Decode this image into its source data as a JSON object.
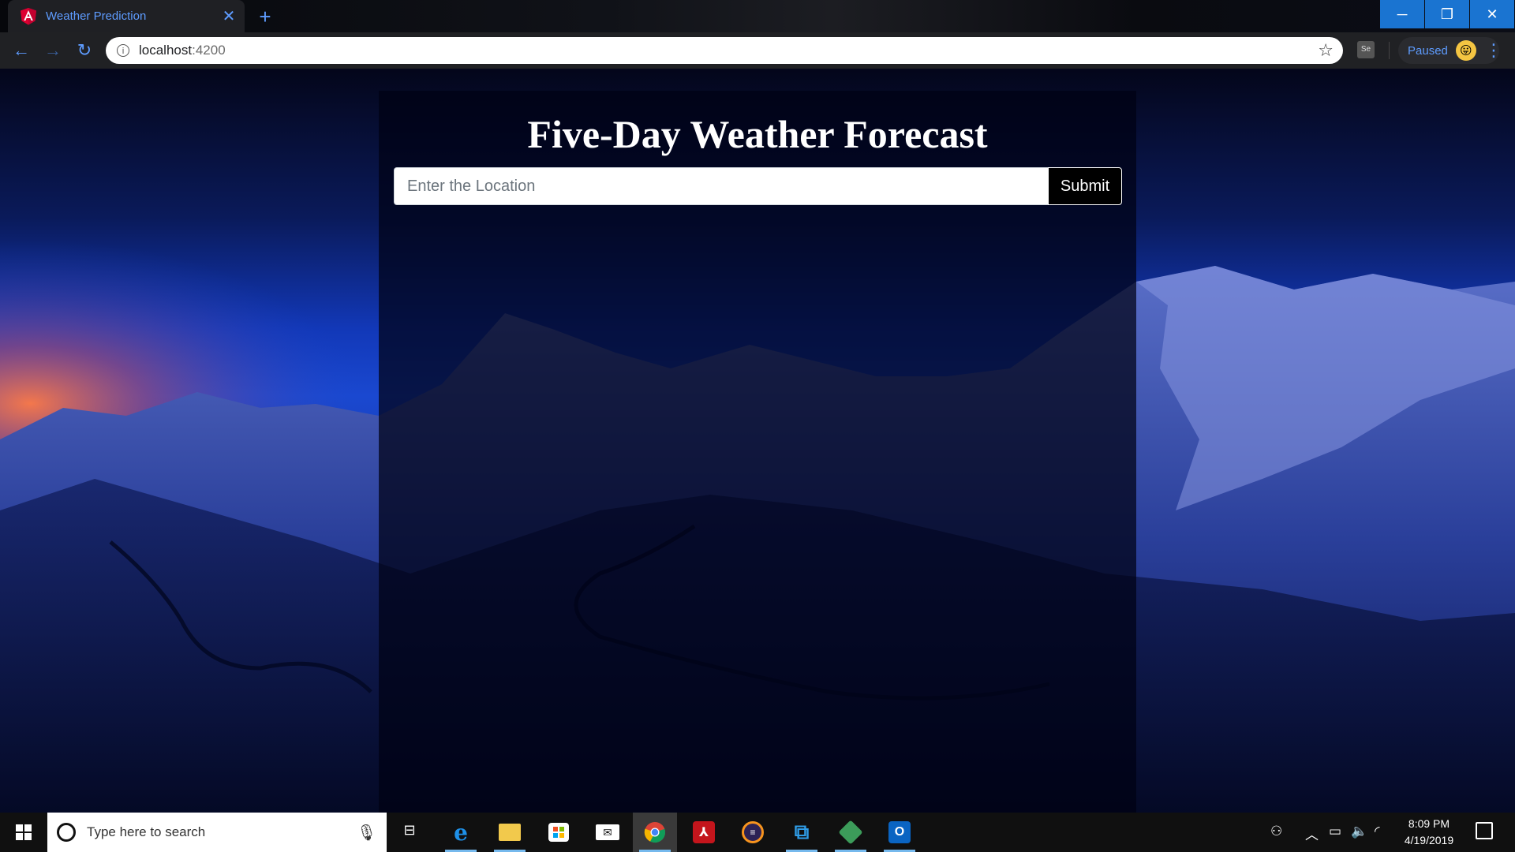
{
  "browser": {
    "tab_title": "Weather Prediction",
    "new_tab_label": "+",
    "url_host": "localhost",
    "url_port": ":4200",
    "profile_status": "Paused",
    "extension_label": "Se"
  },
  "page": {
    "title": "Five-Day Weather Forecast",
    "location_placeholder": "Enter the Location",
    "submit_label": "Submit"
  },
  "taskbar": {
    "search_placeholder": "Type here to search",
    "time": "8:09 PM",
    "date": "4/19/2019",
    "pinned_apps": [
      "edge-icon",
      "file-explorer-icon",
      "store-icon",
      "mail-icon",
      "chrome-icon",
      "acrobat-icon",
      "eclipse-icon",
      "vscode-icon",
      "git-icon",
      "outlook-icon"
    ]
  },
  "colors": {
    "accent": "#5e9cff",
    "window_control": "#1a74d1",
    "taskbar": "#101010"
  }
}
